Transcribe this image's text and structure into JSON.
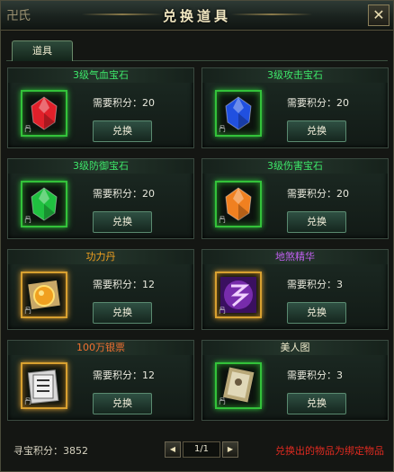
{
  "window": {
    "title": "兑换道具",
    "logo_text": "卍氏",
    "close_glyph": "✕"
  },
  "tabs": [
    {
      "label": "道具",
      "active": true
    }
  ],
  "items": [
    {
      "name": "3级气血宝石",
      "name_color": "#3ee86a",
      "icon": "red-gem-icon",
      "gem_color": "#e0202a",
      "slot": "green",
      "cost_label": "需要积分：20",
      "button_label": "兑换",
      "bind_mark": "冎"
    },
    {
      "name": "3级攻击宝石",
      "name_color": "#3ee86a",
      "icon": "blue-gem-icon",
      "gem_color": "#2050e0",
      "slot": "green",
      "cost_label": "需要积分：20",
      "button_label": "兑换",
      "bind_mark": "冎"
    },
    {
      "name": "3级防御宝石",
      "name_color": "#3ee86a",
      "icon": "green-gem-icon",
      "gem_color": "#20c040",
      "slot": "green",
      "cost_label": "需要积分：20",
      "button_label": "兑换",
      "bind_mark": "冎"
    },
    {
      "name": "3级伤害宝石",
      "name_color": "#3ee86a",
      "icon": "orange-gem-icon",
      "gem_color": "#f08020",
      "slot": "green",
      "cost_label": "需要积分：20",
      "button_label": "兑换",
      "bind_mark": "冎"
    },
    {
      "name": "功力丹",
      "name_color": "#f0a020",
      "icon": "pill-icon",
      "gem_color": "#e8a020",
      "slot": "gold",
      "cost_label": "需要积分：12",
      "button_label": "兑换",
      "bind_mark": "冎"
    },
    {
      "name": "地煞精华",
      "name_color": "#c060f0",
      "icon": "essence-icon",
      "gem_color": "#a040e0",
      "slot": "gold",
      "cost_label": "需要积分：3",
      "button_label": "兑换",
      "bind_mark": "冎"
    },
    {
      "name": "100万银票",
      "name_color": "#f07030",
      "icon": "banknote-icon",
      "gem_color": "#b8b8b8",
      "slot": "gold",
      "cost_label": "需要积分：12",
      "button_label": "兑换",
      "bind_mark": "冎"
    },
    {
      "name": "美人图",
      "name_color": "#f0eccc",
      "icon": "scroll-icon",
      "gem_color": "#c8c0a0",
      "slot": "green",
      "cost_label": "需要积分：3",
      "button_label": "兑换",
      "bind_mark": "冎"
    }
  ],
  "footer": {
    "score_label": "寻宝积分：3852",
    "prev_glyph": "◀",
    "next_glyph": "▶",
    "page_text": "1/1",
    "note": "兑换出的物品为绑定物品"
  },
  "colors": {
    "accent_green": "#33c23a",
    "gold": "#d8a030",
    "warning_red": "#e02a20"
  }
}
